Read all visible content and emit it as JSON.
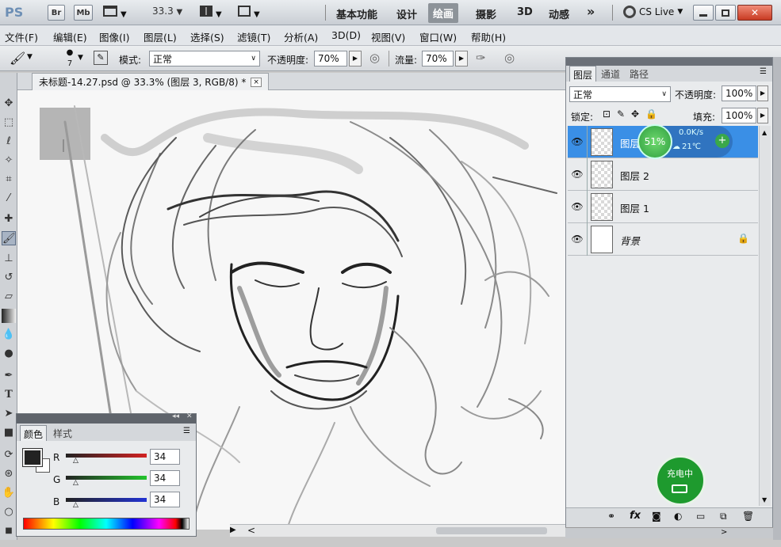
{
  "titlebar": {
    "ps_logo": "PS",
    "bridge_btn": "Br",
    "minibridge_btn": "Mb",
    "zoom": "33.3",
    "workspaces": [
      "基本功能",
      "设计",
      "绘画",
      "摄影",
      "3D",
      "动感"
    ],
    "active_workspace": "绘画",
    "more": "»",
    "cslive": "CS Live"
  },
  "menubar": {
    "items": [
      "文件(F)",
      "编辑(E)",
      "图像(I)",
      "图层(L)",
      "选择(S)",
      "滤镜(T)",
      "分析(A)",
      "3D(D)",
      "视图(V)",
      "窗口(W)",
      "帮助(H)"
    ]
  },
  "options": {
    "brush_size": "7",
    "mode_label": "模式:",
    "mode_value": "正常",
    "opacity_label": "不透明度:",
    "opacity_value": "70%",
    "flow_label": "流量:",
    "flow_value": "70%"
  },
  "document": {
    "tab_title": "未标题-14.27.psd @ 33.3% (图层 3, RGB/8) *",
    "close": "×"
  },
  "layers_panel": {
    "tabs": [
      "图层",
      "通道",
      "路径"
    ],
    "blend_mode": "正常",
    "opacity_label": "不透明度:",
    "opacity_value": "100%",
    "lock_label": "锁定:",
    "fill_label": "填充:",
    "fill_value": "100%",
    "layers": [
      {
        "name": "图层 3",
        "selected": true
      },
      {
        "name": "图层 2",
        "selected": false
      },
      {
        "name": "图层 1",
        "selected": false
      },
      {
        "name": "背景",
        "selected": false
      }
    ]
  },
  "color_panel": {
    "tabs": [
      "颜色",
      "样式"
    ],
    "channels": [
      {
        "label": "R",
        "value": "34",
        "color": "#d22222"
      },
      {
        "label": "G",
        "value": "34",
        "color": "#22c42c"
      },
      {
        "label": "B",
        "value": "34",
        "color": "#2233d4"
      }
    ],
    "foreground": "#222222",
    "background": "#ffffff"
  },
  "overlays": {
    "net_percent": "51%",
    "net_speed": "0.0K/s",
    "net_temp": "21℃",
    "charging": "充电中"
  },
  "colors": {
    "selection_blue": "#3a8fe6",
    "accent": "#2b6fd6"
  }
}
